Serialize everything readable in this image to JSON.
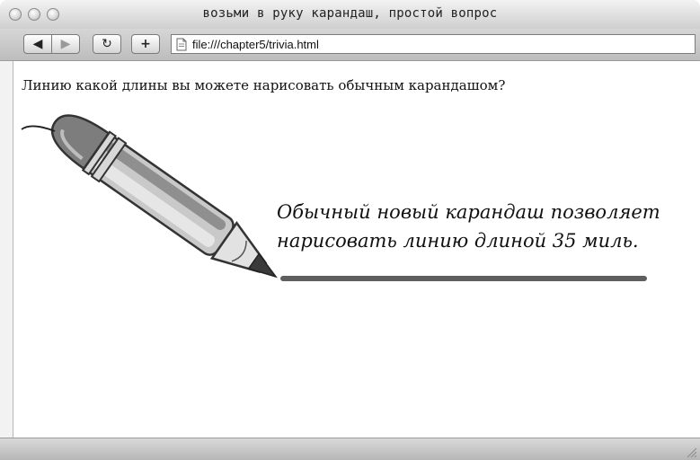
{
  "window": {
    "title": "возьми в руку карандаш, простой вопрос"
  },
  "toolbar": {
    "back_icon": "◀",
    "forward_icon": "▶",
    "reload_icon": "↻",
    "add_icon": "+",
    "address": "file:///chapter5/trivia.html"
  },
  "page": {
    "question": "Линию какой длины вы можете нарисовать обычным карандашом?",
    "answer_line1": "Обычный новый карандаш позволяет",
    "answer_line2": "нарисовать линию длиной 35 миль."
  },
  "icons": {
    "file": "file-icon",
    "pencil": "pencil-illustration",
    "resize": "resize-grip-icon"
  },
  "colors": {
    "chrome": "#cfcfcf",
    "line": "#5f5f5f"
  }
}
